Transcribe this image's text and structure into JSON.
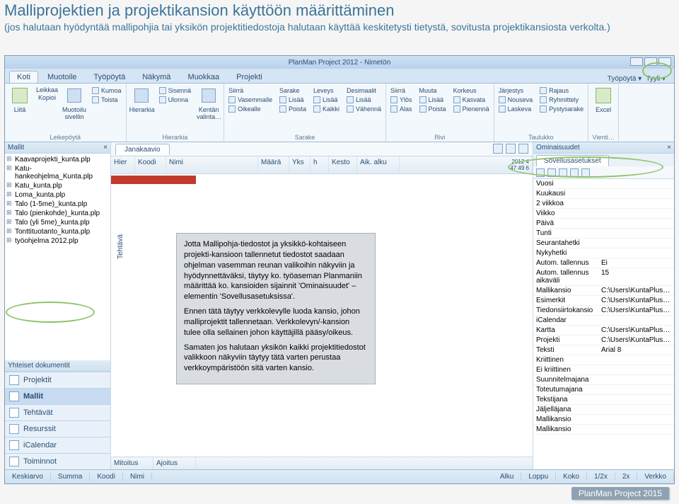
{
  "page": {
    "title": "Malliprojektien ja projektikansion käyttöön määrittäminen",
    "subtitle": "(jos halutaan hyödyntää mallipohjia tai yksikön projektitiedostoja halutaan käyttää keskitetysti tietystä, sovitusta projektikansiosta verkolta.)"
  },
  "app": {
    "title": "PlanMan Project 2012 - Nimetön",
    "tab_right": {
      "work": "Työpöytä ▾",
      "style": "Tyyli ▾"
    },
    "ribbon_tabs": [
      "Koti",
      "Muotoile",
      "Työpöytä",
      "Näkymä",
      "Muokkaa",
      "Projekti"
    ],
    "ribbon_groups": {
      "leikepoyda": {
        "title": "Leikepöytä",
        "paste": "Liitä",
        "cut": "Leikkaa",
        "copy": "Kopioi",
        "brush": "Muotoilu sivellin",
        "undo": "Kumoa",
        "redo": "Toista"
      },
      "hierarkia": {
        "title": "Hierarkia",
        "btn": "Hierarkia",
        "in": "Sisennä",
        "out": "Ulonna",
        "field": "Kentän valinta…"
      },
      "sarake": {
        "title": "Sarake",
        "move": "Siirrä",
        "col": "Sarake",
        "width": "Leveys",
        "dec": "Desimaalit",
        "left": "Vasemmalle",
        "insert": "Lisää",
        "plus": "Lisää",
        "right": "Oikealle",
        "remove": "Poista",
        "all": "Kaikki",
        "minus": "Vähennä"
      },
      "rivi": {
        "title": "Rivi",
        "move": "Siirrä",
        "change": "Muuta",
        "height": "Korkeus",
        "up": "Ylös",
        "add": "Lisää",
        "grow": "Kasvata",
        "down": "Alas",
        "del": "Poista",
        "shrink": "Pienennä"
      },
      "taulukko": {
        "title": "Taulukko",
        "order": "Järjestys",
        "crop": "Rajaus",
        "asc": "Nouseva",
        "group": "Ryhmittely",
        "desc": "Laskeva",
        "break": "Pystysarake"
      },
      "vienti": {
        "title": "Vienti…",
        "excel": "Excel"
      }
    }
  },
  "left": {
    "header": "Mallit",
    "files": [
      "Kaavaprojekti_kunta.plp",
      "Katu-hankeohjelma_Kunta.plp",
      "Katu_kunta.plp",
      "Loma_kunta.plp",
      "Talo (1-5me)_kunta.plp",
      "Talo (pienkohde)_kunta.plp",
      "Talo (yli 5me)_kunta.plp",
      "Tonttituotanto_kunta.plp",
      "työohjelma 2012.plp"
    ],
    "docs_hdr": "Yhteiset dokumentit",
    "nav": [
      {
        "label": "Projektit",
        "sel": false
      },
      {
        "label": "Mallit",
        "sel": true
      },
      {
        "label": "Tehtävät",
        "sel": false
      },
      {
        "label": "Resurssit",
        "sel": false
      },
      {
        "label": "iCalendar",
        "sel": false
      },
      {
        "label": "Toiminnot",
        "sel": false
      }
    ]
  },
  "center": {
    "tab": "Janakaavio",
    "columns": [
      "Hier",
      "Koodi",
      "Nimi",
      "Määrä",
      "Yks",
      "h",
      "Kesto",
      "Aik. alku"
    ],
    "topnums": "2012 4",
    "subnums": "47 49 6",
    "vlabel": "Tehtävä",
    "foot_left": [
      "Mitoitus",
      "Ajoitus"
    ]
  },
  "right": {
    "header": "Ominaisuudet",
    "tab": "Sovellusasetukset",
    "rows": [
      {
        "k": "Vuosi",
        "v": ""
      },
      {
        "k": "Kuukausi",
        "v": ""
      },
      {
        "k": "2 viikkoa",
        "v": ""
      },
      {
        "k": "Viikko",
        "v": ""
      },
      {
        "k": "Päivä",
        "v": ""
      },
      {
        "k": "Tunti",
        "v": ""
      },
      {
        "k": "Seurantahetki",
        "v": ""
      },
      {
        "k": "Nykyhetki",
        "v": ""
      },
      {
        "k": "Autom. tallennus",
        "v": "Ei"
      },
      {
        "k": "Autom. tallennus aikaväli",
        "v": "15"
      },
      {
        "k": "Mallikansio",
        "v": "C:\\Users\\KuntaPlus\\Desktop\\…"
      },
      {
        "k": "Esimerkit",
        "v": "C:\\Users\\KuntaPlus\\Documen…"
      },
      {
        "k": "Tiedonsiirtokansio",
        "v": "C:\\Users\\KuntaPlus\\Documen…"
      },
      {
        "k": "iCalendar",
        "v": ""
      },
      {
        "k": "Kartta",
        "v": "C:\\Users\\KuntaPlus\\Documen…"
      },
      {
        "k": "Projekti",
        "v": "C:\\Users\\KuntaPlus\\Desktop\\…"
      },
      {
        "k": "Teksti",
        "v": "Arial 8"
      },
      {
        "k": "Kriittinen",
        "v": ""
      },
      {
        "k": "Ei kriittinen",
        "v": ""
      },
      {
        "k": "Suunnitelmajana",
        "v": ""
      },
      {
        "k": "Toteutumajana",
        "v": ""
      },
      {
        "k": "Tekstijana",
        "v": ""
      },
      {
        "k": "Jäljelläjana",
        "v": ""
      },
      {
        "k": "Mallikansio",
        "v": ""
      },
      {
        "k": "Mallikansio",
        "v": ""
      }
    ]
  },
  "statusbar": {
    "left": [
      "Keskiarvo",
      "Summa",
      "Koodi",
      "Nimi"
    ],
    "right": [
      "Alku",
      "Loppu",
      "Koko",
      "1/2x",
      "2x",
      "Verkko"
    ]
  },
  "callout": {
    "p1": "Jotta Mallipohja-tiedostot ja yksikkö-kohtaiseen projekti-kansioon tallennetut tiedostot saadaan ohjelman vasemman reunan valikoihin näkyviin ja hyödynnettäväksi, täytyy ko. työaseman Planmaniin määrittää ko. kansioiden sijainnit 'Ominaisuudet' –elementin 'Sovellusasetuksissa'.",
    "p2": "Ennen tätä täytyy verkkolevylle luoda kansio, johon malliprojektit tallennetaan. Verkkolevyn/-kansion tulee olla sellainen johon käyttäjillä pääsy/oikeus.",
    "p3": "Samaten jos halutaan yksikön kaikki projektitiedostot valikkoon näkyviin täytyy tätä varten perustaa verkkoympäristöön sitä varten kansio."
  },
  "footer_badge": "PlanMan Project 2015"
}
